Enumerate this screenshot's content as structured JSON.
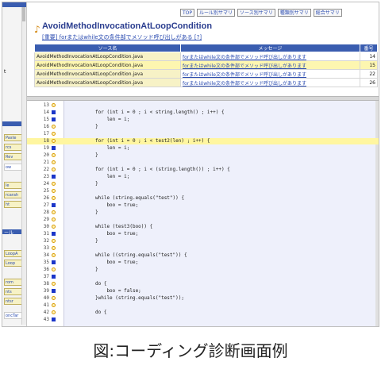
{
  "nav": {
    "items": [
      "TOP",
      "ルール別サマリ",
      "ソース別サマリ",
      "種類別サマリ",
      "総合サマリ"
    ]
  },
  "rule": {
    "title": "AvoidMethodInvocationAtLoopCondition",
    "description": "[重要] forまたはwhile文の条件部でメソッド呼び出しがある [?]"
  },
  "sidebar": {
    "labels": [
      "t",
      "ール"
    ],
    "items": [
      "Paste",
      "rcs",
      "Rev",
      "ow",
      "le",
      "rcarah",
      "ht",
      "LoopA",
      "Loop",
      "rom",
      "nts",
      "ntsr",
      "oncTar"
    ]
  },
  "results_table": {
    "headers": [
      "ソース名",
      "メッセージ",
      "番号"
    ],
    "rows": [
      {
        "source": "AvoidMethodInvocationAtLoopCondition.java",
        "message": "forまたはwhile文の条件部でメソッド呼び出しがあります",
        "line": "14",
        "highlight": false
      },
      {
        "source": "AvoidMethodInvocationAtLoopCondition.java",
        "message": "forまたはwhile文の条件部でメソッド呼び出しがあります",
        "line": "15",
        "highlight": true
      },
      {
        "source": "AvoidMethodInvocationAtLoopCondition.java",
        "message": "forまたはwhile文の条件部でメソッド呼び出しがあります",
        "line": "22",
        "highlight": false
      },
      {
        "source": "AvoidMethodInvocationAtLoopCondition.java",
        "message": "forまたはwhile文の条件部でメソッド呼び出しがあります",
        "line": "26",
        "highlight": false
      }
    ]
  },
  "code": {
    "highlight_line": "18",
    "lines": [
      {
        "n": "13",
        "m": "circle",
        "t": ""
      },
      {
        "n": "14",
        "m": "square",
        "t": "for (int i = 0 ; i < string.length() ; i++) {"
      },
      {
        "n": "15",
        "m": "square",
        "t": "    len = i;"
      },
      {
        "n": "16",
        "m": "circle",
        "t": "}"
      },
      {
        "n": "17",
        "m": "circle",
        "t": ""
      },
      {
        "n": "18",
        "m": "circle",
        "t": "for (int i = 0 ; i < test2(len) ; i++) {"
      },
      {
        "n": "19",
        "m": "square",
        "t": "    len = i;"
      },
      {
        "n": "20",
        "m": "circle",
        "t": "}"
      },
      {
        "n": "21",
        "m": "circle",
        "t": ""
      },
      {
        "n": "22",
        "m": "circle",
        "t": "for (int i = 0 ; i < (string.length()) ; i++) {"
      },
      {
        "n": "23",
        "m": "square",
        "t": "    len = i;"
      },
      {
        "n": "24",
        "m": "circle",
        "t": "}"
      },
      {
        "n": "25",
        "m": "circle",
        "t": ""
      },
      {
        "n": "26",
        "m": "circle",
        "t": "while (string.equals(\"test\")) {"
      },
      {
        "n": "27",
        "m": "square",
        "t": "    boo = true;"
      },
      {
        "n": "28",
        "m": "circle",
        "t": "}"
      },
      {
        "n": "29",
        "m": "circle",
        "t": ""
      },
      {
        "n": "30",
        "m": "circle",
        "t": "while (test3(boo)) {"
      },
      {
        "n": "31",
        "m": "square",
        "t": "    boo = true;"
      },
      {
        "n": "32",
        "m": "circle",
        "t": "}"
      },
      {
        "n": "33",
        "m": "circle",
        "t": ""
      },
      {
        "n": "34",
        "m": "circle",
        "t": "while ((string.equals(\"test\")) {"
      },
      {
        "n": "35",
        "m": "square",
        "t": "    boo = true;"
      },
      {
        "n": "36",
        "m": "circle",
        "t": "}"
      },
      {
        "n": "37",
        "m": "square",
        "t": ""
      },
      {
        "n": "38",
        "m": "circle",
        "t": "do {"
      },
      {
        "n": "39",
        "m": "square",
        "t": "    boo = false;"
      },
      {
        "n": "40",
        "m": "circle",
        "t": "}while (string.equals(\"test\"));"
      },
      {
        "n": "41",
        "m": "circle",
        "t": ""
      },
      {
        "n": "42",
        "m": "circle",
        "t": "do {"
      },
      {
        "n": "43",
        "m": "square",
        "t": ""
      }
    ]
  },
  "caption": "図:コーディング診断画面例",
  "colors": {
    "header_blue": "#3a5db0",
    "link_blue": "#2a4bb0",
    "highlight_yellow": "#fff6a0",
    "code_background": "#eef0fb",
    "marker_orange": "#d89a00",
    "marker_blue": "#1b36c9"
  },
  "icons": {
    "rule": "rule-flag-icon",
    "issue_marker": "issue-circle-icon",
    "line_marker": "line-square-icon"
  }
}
